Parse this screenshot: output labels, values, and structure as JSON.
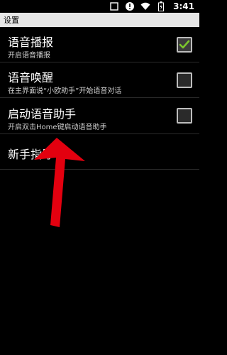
{
  "status": {
    "time": "3:41",
    "icons": [
      "blank-icon",
      "alert-icon",
      "wifi-icon",
      "battery-icon"
    ]
  },
  "titlebar": {
    "title": "设置"
  },
  "settings": [
    {
      "title": "语音播报",
      "subtitle": "开启语音播报",
      "checked": true
    },
    {
      "title": "语音唤醒",
      "subtitle": "在主界面说“小欧助手”开始语音对话",
      "checked": false
    },
    {
      "title": "启动语音助手",
      "subtitle": "开启双击Home键启动语音助手",
      "checked": false
    },
    {
      "title": "新手指导"
    }
  ],
  "colors": {
    "check": "#7cc62d",
    "arrow": "#e3000f"
  }
}
